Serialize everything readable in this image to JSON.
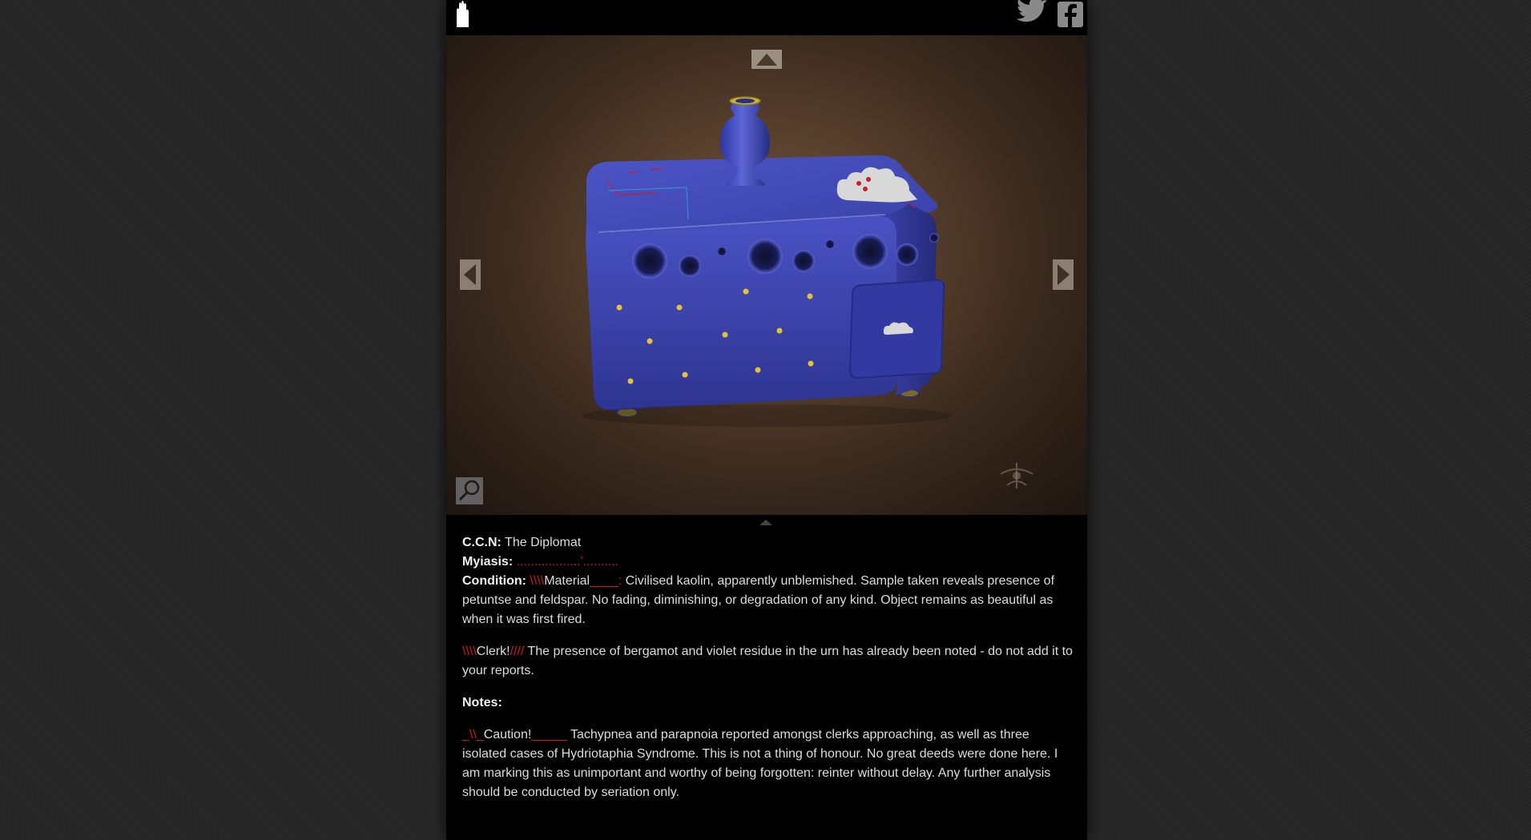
{
  "header": {
    "logo_icon": "hand-icon",
    "social": [
      {
        "name": "twitter",
        "icon": "twitter-bird-icon"
      },
      {
        "name": "facebook",
        "icon": "facebook-f-icon"
      }
    ]
  },
  "viewer": {
    "controls": {
      "up": "triangle-up-icon",
      "left": "triangle-left-icon",
      "right": "triangle-right-icon",
      "zoom": "magnifier-icon"
    },
    "object_colors": {
      "body": "#3e45b0",
      "stars": "#e3c23a",
      "background": "#5a412e"
    }
  },
  "info": {
    "ccn_label": "C.C.N:",
    "ccn_value": "The Diplomat",
    "myiasis_label": "Myiasis:",
    "myiasis_value": "..................'..........",
    "condition_label": "Condition:",
    "condition_prefix": "\\\\\\\\",
    "condition_word": "Material",
    "condition_suffix": "____:",
    "condition_text": "Civilised kaolin, apparently unblemished. Sample taken reveals presence of petuntse and feldspar. No fading, diminishing, or degradation of any kind. Object remains as beautiful as when it was first fired.",
    "clerk_prefix": "\\\\\\\\",
    "clerk_word": "Clerk!",
    "clerk_suffix": "////",
    "clerk_text": "The presence of bergamot and violet residue in the urn has already been noted - do not add it to your reports.",
    "notes_label": "Notes:",
    "caution_prefix": "_\\\\_",
    "caution_word": "Caution!",
    "caution_suffix": "_____",
    "caution_text": "Tachypnea and parapnoia reported amongst clerks approaching, as well as three isolated cases of Hydriotaphia Syndrome. This is not a thing of honour. No great deeds were done here. I am marking this as unimportant and worthy of being forgotten: reinter without delay. Any further analysis should be conducted by seriation only."
  },
  "colors": {
    "accent_red": "#d0191b",
    "text": "#dcdcdc",
    "panel": "#000000",
    "page": "#262626"
  }
}
